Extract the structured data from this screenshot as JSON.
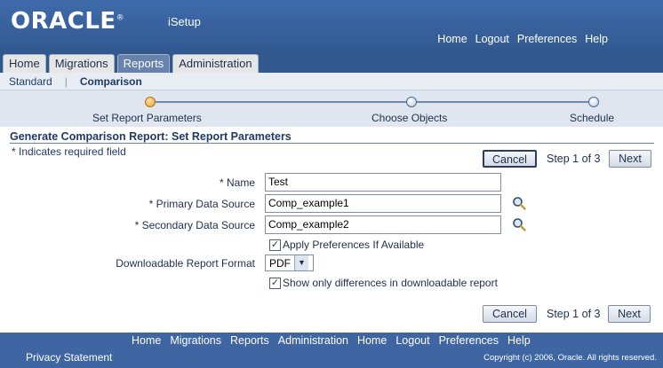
{
  "header": {
    "logo": "ORACLE",
    "logo_mark": "®",
    "product": "iSetup",
    "global_links": [
      "Home",
      "Logout",
      "Preferences",
      "Help"
    ]
  },
  "tabs": [
    {
      "label": "Home",
      "active": false
    },
    {
      "label": "Migrations",
      "active": false
    },
    {
      "label": "Reports",
      "active": true
    },
    {
      "label": "Administration",
      "active": false
    }
  ],
  "subtabs": [
    {
      "label": "Standard",
      "active": false
    },
    {
      "label": "Comparison",
      "active": true
    }
  ],
  "train": {
    "steps": [
      "Set Report Parameters",
      "Choose Objects",
      "Schedule"
    ],
    "current": 0
  },
  "page": {
    "title": "Generate Comparison Report: Set Report Parameters",
    "required_note": "* Indicates required field",
    "step_text": "Step 1 of 3",
    "cancel_label": "Cancel",
    "next_label": "Next"
  },
  "form": {
    "name_label": "* Name",
    "name_value": "Test",
    "primary_label": "* Primary Data Source",
    "primary_value": "Comp_example1",
    "secondary_label": "* Secondary Data Source",
    "secondary_value": "Comp_example2",
    "apply_prefs_label": "Apply Preferences If Available",
    "apply_prefs_checked": true,
    "format_label": "Downloadable Report Format",
    "format_value": "PDF",
    "diff_only_label": "Show only differences in downloadable report",
    "diff_only_checked": true
  },
  "footer": {
    "links": [
      "Home",
      "Migrations",
      "Reports",
      "Administration",
      "Home",
      "Logout",
      "Preferences",
      "Help"
    ],
    "privacy": "Privacy Statement",
    "copyright": "Copyright (c) 2006, Oracle. All rights reserved."
  },
  "colors": {
    "brand_blue": "#3f6bab",
    "active_tab": "#6682ad",
    "train_current": "#f29d1c"
  }
}
